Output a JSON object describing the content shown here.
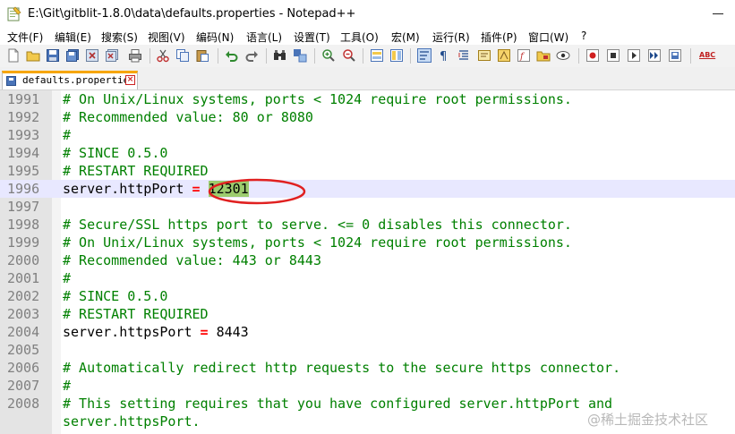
{
  "window": {
    "title": "E:\\Git\\gitblit-1.8.0\\data\\defaults.properties - Notepad++"
  },
  "menu": [
    "文件(F)",
    "编辑(E)",
    "搜索(S)",
    "视图(V)",
    "编码(N)",
    "语言(L)",
    "设置(T)",
    "工具(O)",
    "宏(M)",
    "运行(R)",
    "插件(P)",
    "窗口(W)",
    "?"
  ],
  "toolbar": {
    "buttons": [
      "new-file-icon",
      "open-file-icon",
      "save-icon",
      "save-all-icon",
      "close-icon",
      "close-all-icon",
      "print-icon",
      "cut-icon",
      "copy-icon",
      "paste-icon",
      "undo-icon",
      "redo-icon",
      "find-icon",
      "replace-icon",
      "zoom-in-icon",
      "zoom-out-icon",
      "sync-vertical-icon",
      "sync-horizontal-icon",
      "word-wrap-icon",
      "show-all-chars-icon",
      "indent-guide-icon",
      "language-icon",
      "doc-map-icon",
      "function-list-icon",
      "folder-workspace-icon",
      "monitoring-icon",
      "record-macro-icon",
      "stop-macro-icon",
      "play-macro-icon",
      "run-macro-multiple-icon",
      "save-macro-icon",
      "spell-check-icon"
    ],
    "spell_label": "ABC"
  },
  "tabs": [
    {
      "label": "defaults.properties",
      "active": true
    }
  ],
  "editor": {
    "lines": [
      {
        "num": "1991",
        "kind": "comment",
        "text": "# On Unix/Linux systems, ports < 1024 require root permissions."
      },
      {
        "num": "1992",
        "kind": "comment",
        "text": "# Recommended value: 80 or 8080"
      },
      {
        "num": "1993",
        "kind": "comment",
        "text": "#"
      },
      {
        "num": "1994",
        "kind": "comment",
        "text": "# SINCE 0.5.0"
      },
      {
        "num": "1995",
        "kind": "comment",
        "text": "# RESTART REQUIRED"
      },
      {
        "num": "1996",
        "kind": "prop",
        "key": "server.httpPort",
        "op": "=",
        "value": "12301",
        "current": true,
        "highlight": true
      },
      {
        "num": "1997",
        "kind": "blank",
        "text": ""
      },
      {
        "num": "1998",
        "kind": "comment",
        "text": "# Secure/SSL https port to serve. <= 0 disables this connector."
      },
      {
        "num": "1999",
        "kind": "comment",
        "text": "# On Unix/Linux systems, ports < 1024 require root permissions."
      },
      {
        "num": "2000",
        "kind": "comment",
        "text": "# Recommended value: 443 or 8443"
      },
      {
        "num": "2001",
        "kind": "comment",
        "text": "#"
      },
      {
        "num": "2002",
        "kind": "comment",
        "text": "# SINCE 0.5.0"
      },
      {
        "num": "2003",
        "kind": "comment",
        "text": "# RESTART REQUIRED"
      },
      {
        "num": "2004",
        "kind": "prop",
        "key": "server.httpsPort",
        "op": "=",
        "value": "8443"
      },
      {
        "num": "2005",
        "kind": "blank",
        "text": ""
      },
      {
        "num": "2006",
        "kind": "comment",
        "text": "# Automatically redirect http requests to the secure https connector."
      },
      {
        "num": "2007",
        "kind": "comment",
        "text": "#"
      },
      {
        "num": "2008",
        "kind": "comment",
        "text": "# This setting requires that you have configured server.httpPort and"
      },
      {
        "num": "",
        "kind": "comment",
        "text": "server.httpsPort."
      }
    ]
  },
  "watermark": "@稀土掘金技术社区",
  "colors": {
    "comment": "#008000",
    "operator": "#ff0000",
    "current_line": "#e8e8ff",
    "value_highlight": "#9ccc6e",
    "annotation": "#e02020",
    "tab_accent": "#f7a600"
  }
}
